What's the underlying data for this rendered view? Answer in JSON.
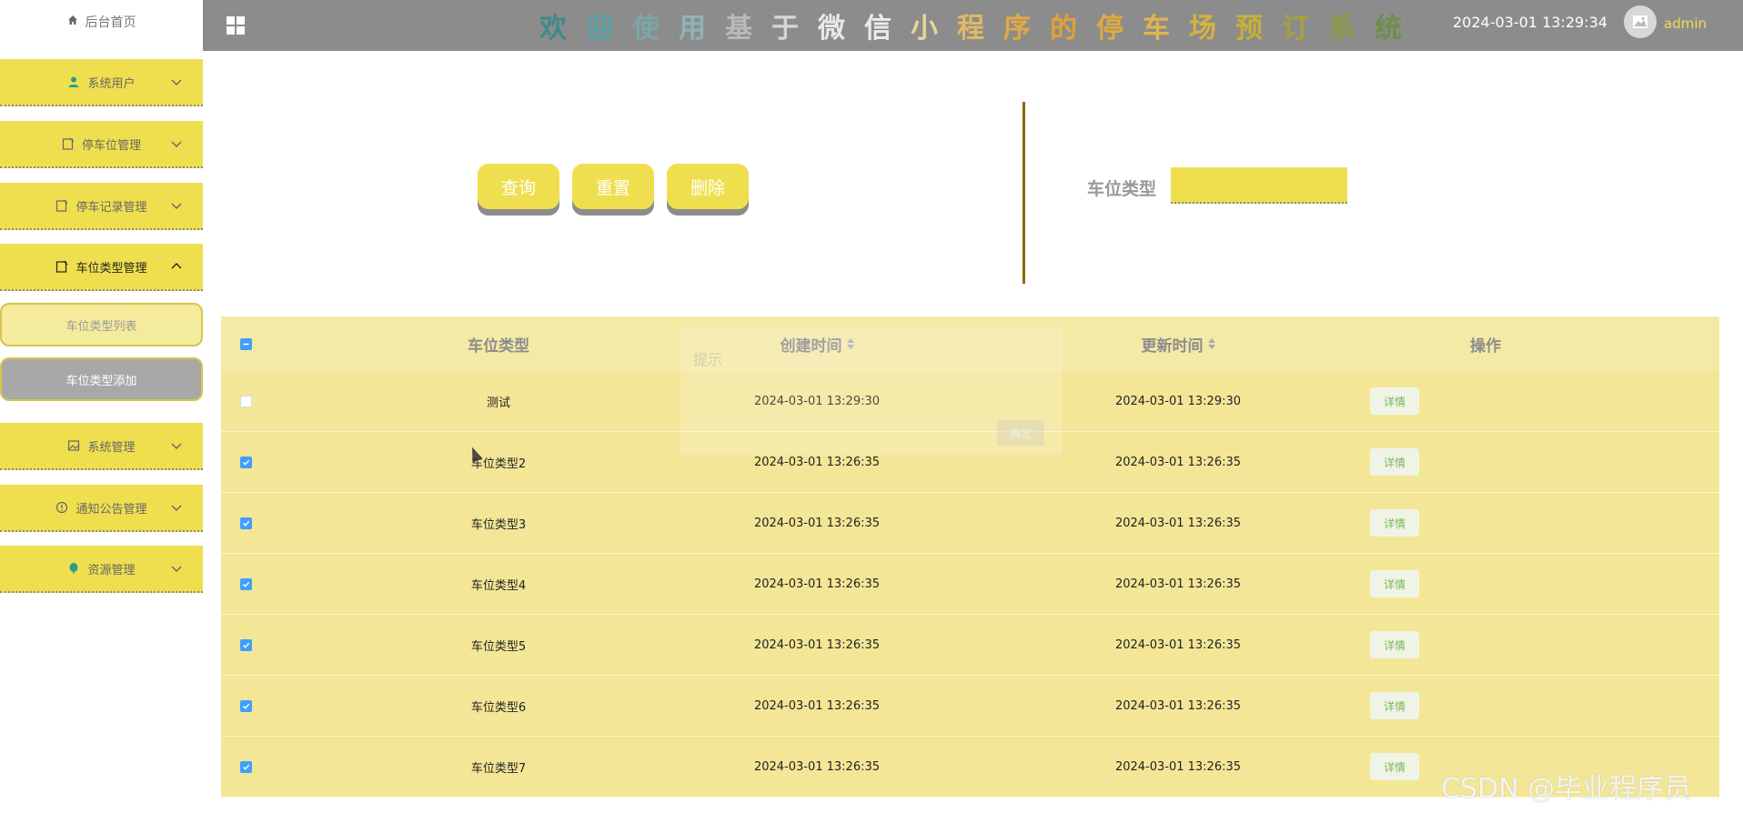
{
  "sidebar": {
    "home_label": "后台首页",
    "items": [
      {
        "label": "系统用户",
        "icon": "user-icon"
      },
      {
        "label": "停车位管理",
        "icon": "doc-icon"
      },
      {
        "label": "停车记录管理",
        "icon": "doc-icon"
      },
      {
        "label": "车位类型管理",
        "icon": "doc-icon"
      },
      {
        "label": "系统管理",
        "icon": "image-icon"
      },
      {
        "label": "通知公告管理",
        "icon": "info-icon"
      },
      {
        "label": "资源管理",
        "icon": "balloon-icon"
      }
    ],
    "subitems": [
      {
        "label": "车位类型列表"
      },
      {
        "label": "车位类型添加"
      }
    ]
  },
  "header": {
    "title": "欢迎使用基于微信小程序的停车场预订系统",
    "datetime": "2024-03-01 13:29:34",
    "username": "admin",
    "title_colors": [
      "#3f8a8a",
      "#5a9fa6",
      "#7aa7a6",
      "#8fb4b3",
      "#b9b9b9",
      "#d6d6d6",
      "#e8e8e8",
      "#ececec",
      "#e6d59a",
      "#e2b865",
      "#e0aa42",
      "#e1a233",
      "#e0aa40",
      "#e2b34d",
      "#d6b23e",
      "#c9b036",
      "#a8a13c",
      "#8a9a44",
      "#6f8f49"
    ]
  },
  "toolbar": {
    "query_label": "查询",
    "reset_label": "重置",
    "delete_label": "删除",
    "filter_label": "车位类型",
    "filter_value": ""
  },
  "table": {
    "headers": {
      "type": "车位类型",
      "created": "创建时间",
      "updated": "更新时间",
      "op": "操作"
    },
    "rows": [
      {
        "type": "测试",
        "created": "2024-03-01 13:29:30",
        "updated": "2024-03-01 13:29:30",
        "action": "详情",
        "checked": false
      },
      {
        "type": "车位类型2",
        "created": "2024-03-01 13:26:35",
        "updated": "2024-03-01 13:26:35",
        "action": "详情",
        "checked": true
      },
      {
        "type": "车位类型3",
        "created": "2024-03-01 13:26:35",
        "updated": "2024-03-01 13:26:35",
        "action": "详情",
        "checked": true
      },
      {
        "type": "车位类型4",
        "created": "2024-03-01 13:26:35",
        "updated": "2024-03-01 13:26:35",
        "action": "详情",
        "checked": true
      },
      {
        "type": "车位类型5",
        "created": "2024-03-01 13:26:35",
        "updated": "2024-03-01 13:26:35",
        "action": "详情",
        "checked": true
      },
      {
        "type": "车位类型6",
        "created": "2024-03-01 13:26:35",
        "updated": "2024-03-01 13:26:35",
        "action": "详情",
        "checked": true
      },
      {
        "type": "车位类型7",
        "created": "2024-03-01 13:26:35",
        "updated": "2024-03-01 13:26:35",
        "action": "详情",
        "checked": true
      }
    ]
  },
  "overlay": {
    "title": "提示",
    "confirm_label": "确定"
  },
  "watermark": "CSDN @毕业程序员",
  "colors": {
    "accent": "#efdf4f",
    "topbar": "#8c8c8c",
    "checkbox": "#409eff"
  }
}
